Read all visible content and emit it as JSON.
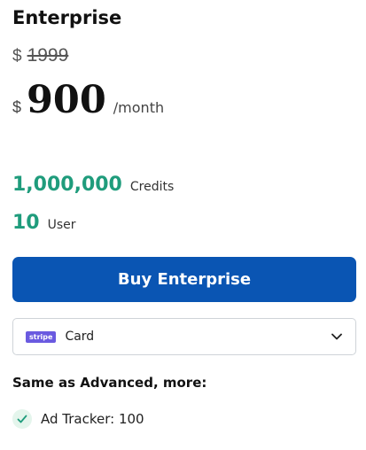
{
  "plan": {
    "title": "Enterprise",
    "old_price": {
      "currency": "$",
      "value": "1999"
    },
    "price": {
      "currency": "$",
      "amount": "900",
      "period": "/month"
    }
  },
  "quotas": [
    {
      "value": "1,000,000",
      "unit": "Credits"
    },
    {
      "value": "10",
      "unit": "User"
    }
  ],
  "buy_button": {
    "label": "Buy Enterprise"
  },
  "payment_select": {
    "badge": "stripe",
    "value": "Card"
  },
  "features": {
    "title": "Same as Advanced, more:",
    "items": [
      {
        "label": "Ad Tracker: 100"
      }
    ]
  },
  "colors": {
    "accent_green": "#1f9c7c",
    "button_blue": "#0a55b3",
    "stripe_purple": "#6a5ae0"
  }
}
